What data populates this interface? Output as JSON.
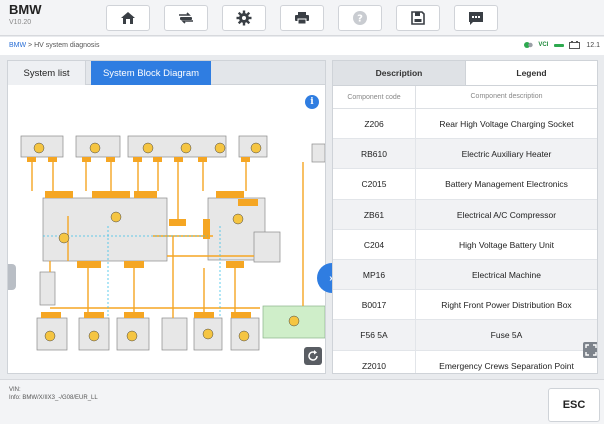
{
  "app": {
    "name": "BMW",
    "version": "V10.20"
  },
  "toolbar": {
    "buttons": [
      {
        "name": "home-button",
        "icon": "home-icon"
      },
      {
        "name": "vehicle-swap-button",
        "icon": "car-swap-icon"
      },
      {
        "name": "settings-button",
        "icon": "gear-icon"
      },
      {
        "name": "print-button",
        "icon": "printer-icon"
      },
      {
        "name": "help-button",
        "icon": "help-icon"
      },
      {
        "name": "save-button",
        "icon": "save-icon"
      },
      {
        "name": "message-button",
        "icon": "chat-icon"
      }
    ]
  },
  "breadcrumb": {
    "root": "BMW",
    "separator": " > ",
    "current": "HV system diagnosis"
  },
  "status": {
    "vci_label": "VCI",
    "battery_text": "12.1",
    "accent_green": "#2da94f"
  },
  "left_tabs": {
    "system_list": "System list",
    "block_diagram": "System Block Diagram"
  },
  "info_icon_glyph": "i",
  "expand_glyph": "»",
  "right_tabs": {
    "description": "Description",
    "legend": "Legend"
  },
  "table": {
    "headers": {
      "code": "Component code",
      "description": "Component description"
    },
    "rows": [
      {
        "code": "Z206",
        "description": "Rear High Voltage Charging Socket"
      },
      {
        "code": "RB610",
        "description": "Electric Auxiliary Heater"
      },
      {
        "code": "C2015",
        "description": "Battery Management Electronics"
      },
      {
        "code": "ZB61",
        "description": "Electrical A/C Compressor"
      },
      {
        "code": "C204",
        "description": "High Voltage Battery Unit"
      },
      {
        "code": "MP16",
        "description": "Electrical Machine"
      },
      {
        "code": "B0017",
        "description": "Right Front Power Distribution Box"
      },
      {
        "code": "F56 5A",
        "description": "Fuse 5A"
      },
      {
        "code": "Z2010",
        "description": "Emergency Crews Separation Point"
      }
    ]
  },
  "footer": {
    "vin_label": "VIN:",
    "info_text": "Info: BMW/X/IIX3_-/G08/EUR_LL",
    "esc_label": "ESC"
  },
  "colors": {
    "accent_blue": "#2f7de1",
    "wire_orange": "#f5a623",
    "box_gray": "#e7e7e7",
    "box_green": "#cfeec9"
  }
}
